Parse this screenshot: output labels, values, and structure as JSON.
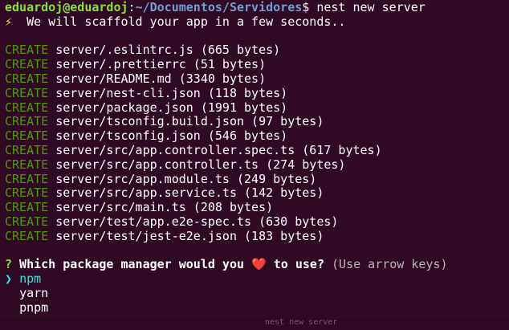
{
  "prompt": {
    "user_host": "eduardoj@eduardoj",
    "separator": ":",
    "path": "~/Documentos/Servidores",
    "symbol": "$",
    "command": " nest new server"
  },
  "scaffold_message": {
    "icon": "⚡",
    "text": "  We will scaffold your app in a few seconds.."
  },
  "create_label": "CREATE",
  "files": [
    " server/.eslintrc.js (665 bytes)",
    " server/.prettierrc (51 bytes)",
    " server/README.md (3340 bytes)",
    " server/nest-cli.json (118 bytes)",
    " server/package.json (1991 bytes)",
    " server/tsconfig.build.json (97 bytes)",
    " server/tsconfig.json (546 bytes)",
    " server/src/app.controller.spec.ts (617 bytes)",
    " server/src/app.controller.ts (274 bytes)",
    " server/src/app.module.ts (249 bytes)",
    " server/src/app.service.ts (142 bytes)",
    " server/src/main.ts (208 bytes)",
    " server/test/app.e2e-spec.ts (630 bytes)",
    " server/test/jest-e2e.json (183 bytes)"
  ],
  "question": {
    "mark": "?",
    "text_before": " Which package manager would you ",
    "heart": "❤️",
    "text_after": " to use?",
    "hint": " (Use arrow keys)"
  },
  "options": {
    "pointer": "❯",
    "items": [
      "npm",
      "yarn",
      "pnpm"
    ],
    "selected": "npm"
  },
  "ghost_text": "nest new server",
  "colors": {
    "background": "#300a24",
    "create_green": "#4e9a06",
    "prompt_green": "#8ae234",
    "path_blue": "#729fcf",
    "selected_cyan": "#34e2e2",
    "heart_red": "#ef2929"
  }
}
